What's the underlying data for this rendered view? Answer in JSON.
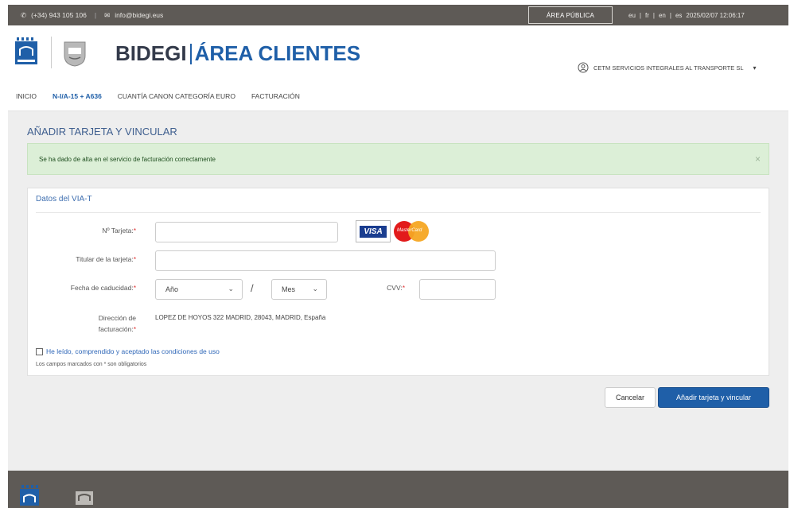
{
  "topbar": {
    "phone": "(+34) 943 105 106",
    "email": "info@bidegi.eus",
    "public_area": "ÁREA PÚBLICA",
    "languages": [
      "eu",
      "fr",
      "en",
      "es"
    ],
    "datetime": "2025/02/07 12:06:17"
  },
  "header": {
    "brand_name": "BIDEGI",
    "brand_area": "ÁREA CLIENTES",
    "user_company": "CETM SERVICIOS INTEGRALES AL TRANSPORTE SL"
  },
  "nav": {
    "items": [
      "INICIO",
      "N-I/A-15 + A636",
      "CUANTÍA CANON CATEGORÍA EURO",
      "FACTURACIÓN"
    ],
    "active_index": 1
  },
  "page": {
    "title": "AÑADIR TARJETA Y VINCULAR"
  },
  "alert": {
    "message": "Se ha dado de alta en el servicio de facturación correctamente",
    "close": "×"
  },
  "form": {
    "section_title": "Datos del VIA-T",
    "card_number_label": "Nº Tarjeta:",
    "card_holder_label": "Titular de la tarjeta:",
    "expiry_label": "Fecha de caducidad:",
    "year_placeholder": "Año",
    "month_placeholder": "Mes",
    "separator": "/",
    "cvv_label": "CVV:",
    "address_label_line1": "Dirección de",
    "address_label_line2": "facturación:",
    "address_value": "LOPEZ DE HOYOS 322 MADRID, 28043, MADRID, España",
    "required_mark": "*",
    "terms_text": "He leído, comprendido y aceptado las condiciones de uso",
    "required_note": "Los campos marcados con * son obligatorios",
    "visa_text": "VISA",
    "mastercard_text": "MasterCard"
  },
  "buttons": {
    "cancel": "Cancelar",
    "submit": "Añadir tarjeta y vincular"
  },
  "colors": {
    "primary": "#1f5fa8",
    "topbar_bg": "#5e5a56",
    "alert_bg": "#dcefd7",
    "page_bg": "#eeeeee"
  }
}
